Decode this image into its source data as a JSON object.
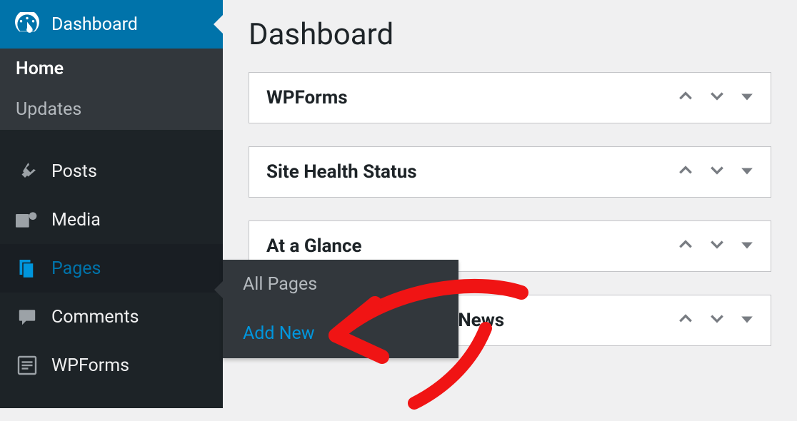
{
  "page_title": "Dashboard",
  "sidebar": {
    "dashboard": {
      "label": "Dashboard"
    },
    "sub": {
      "home": "Home",
      "updates": "Updates"
    },
    "posts": {
      "label": "Posts"
    },
    "media": {
      "label": "Media"
    },
    "pages": {
      "label": "Pages"
    },
    "comments": {
      "label": "Comments"
    },
    "wpforms": {
      "label": "WPForms"
    }
  },
  "flyout": {
    "all_pages": "All Pages",
    "add_new": "Add New"
  },
  "widgets": [
    {
      "title": "WPForms"
    },
    {
      "title": "Site Health Status"
    },
    {
      "title": "At a Glance"
    },
    {
      "title": "WordPress Events and News"
    }
  ]
}
